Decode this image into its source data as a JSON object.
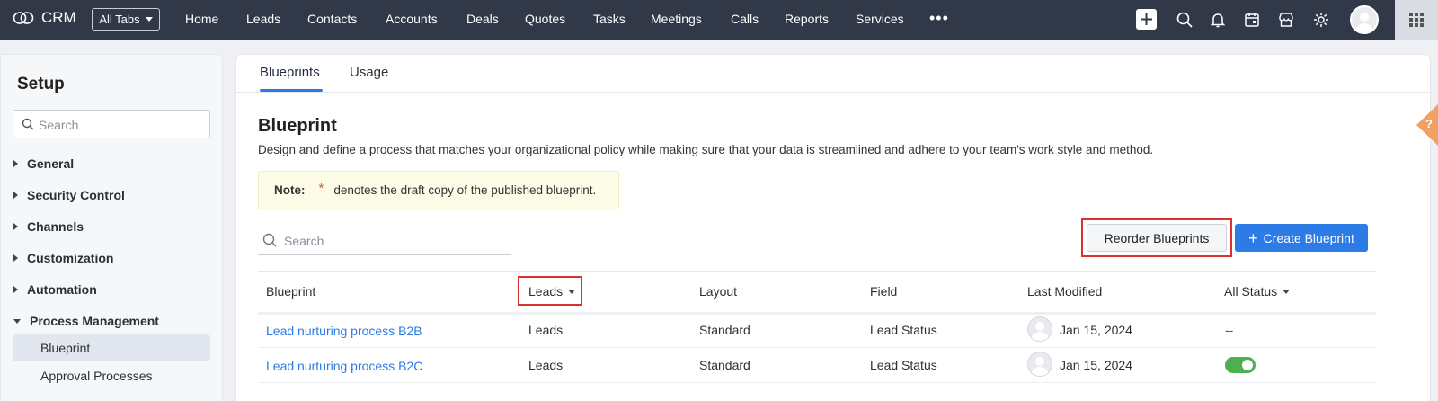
{
  "topbar": {
    "app_name": "CRM",
    "all_tabs_label": "All Tabs",
    "nav_items": [
      "Home",
      "Leads",
      "Contacts",
      "Accounts",
      "Deals",
      "Quotes",
      "Tasks",
      "Meetings",
      "Calls",
      "Reports",
      "Services"
    ],
    "more_label": "•••"
  },
  "sidebar": {
    "title": "Setup",
    "search_placeholder": "Search",
    "groups": [
      "General",
      "Security Control",
      "Channels",
      "Customization",
      "Automation",
      "Process Management"
    ],
    "sub_items": [
      "Blueprint",
      "Approval Processes"
    ]
  },
  "main": {
    "tabs": [
      "Blueprints",
      "Usage"
    ],
    "title": "Blueprint",
    "description": "Design and define a process that matches your organizational policy while making sure that your data is streamlined and adhere to your team's work style and method.",
    "note": {
      "label": "Note:",
      "star": "*",
      "text": "denotes the draft copy of the published blueprint."
    },
    "search_placeholder": "Search",
    "reorder_label": "Reorder Blueprints",
    "create_label": "Create Blueprint",
    "create_icon": "+",
    "table": {
      "headers": [
        "Blueprint",
        "Leads",
        "Layout",
        "Field",
        "Last Modified",
        "All Status"
      ],
      "rows": [
        {
          "name": "Lead nurturing process B2B",
          "module": "Leads",
          "layout": "Standard",
          "field": "Lead Status",
          "modified": "Jan 15, 2024",
          "status": "--"
        },
        {
          "name": "Lead nurturing process B2C",
          "module": "Leads",
          "layout": "Standard",
          "field": "Lead Status",
          "modified": "Jan 15, 2024",
          "status_toggle": "on"
        }
      ]
    }
  },
  "help_label": "?",
  "colors": {
    "topbar": "#313949",
    "accent_blue": "#2d7be5",
    "highlight_red": "#d9312f",
    "toggle_green": "#4caf50",
    "help_orange": "#f0a060"
  }
}
